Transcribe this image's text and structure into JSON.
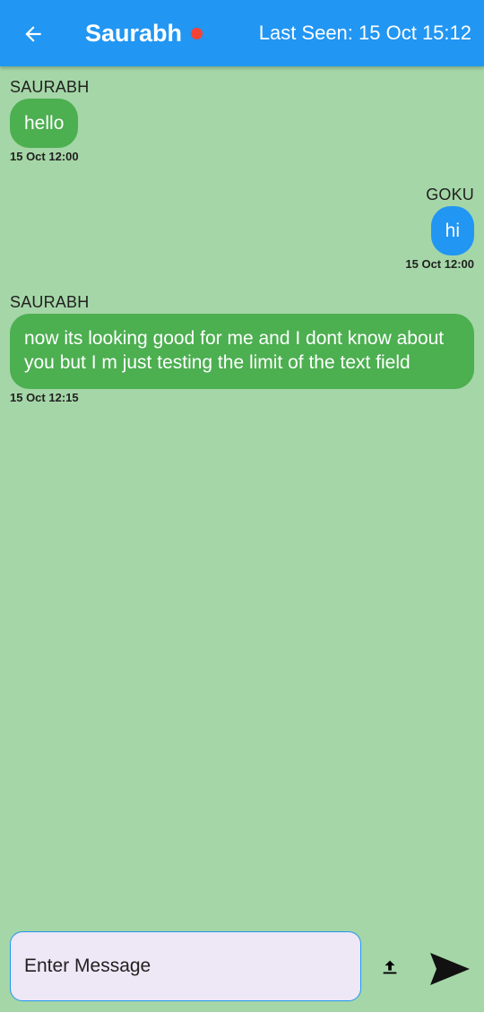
{
  "header": {
    "title": "Saurabh",
    "status_color": "#F44336",
    "last_seen": "Last Seen: 15 Oct 15:12",
    "back_icon": "arrow-left-icon"
  },
  "messages": [
    {
      "sender": "SAURABH",
      "text": "hello",
      "time": "15 Oct 12:00",
      "side": "left",
      "color": "#4CAF50"
    },
    {
      "sender": "GOKU",
      "text": "hi",
      "time": "15 Oct 12:00",
      "side": "right",
      "color": "#2196F3"
    },
    {
      "sender": "SAURABH",
      "text": "now its looking good for me and I dont know about you but I m just testing the limit of the text field",
      "time": "15 Oct 12:15",
      "side": "left",
      "color": "#4CAF50"
    }
  ],
  "composer": {
    "placeholder": "Enter Message",
    "upload_icon": "upload-icon",
    "send_icon": "send-icon"
  },
  "colors": {
    "app_bar": "#2196F3",
    "background": "#A5D6A7",
    "input_background": "#EDE7F6"
  }
}
